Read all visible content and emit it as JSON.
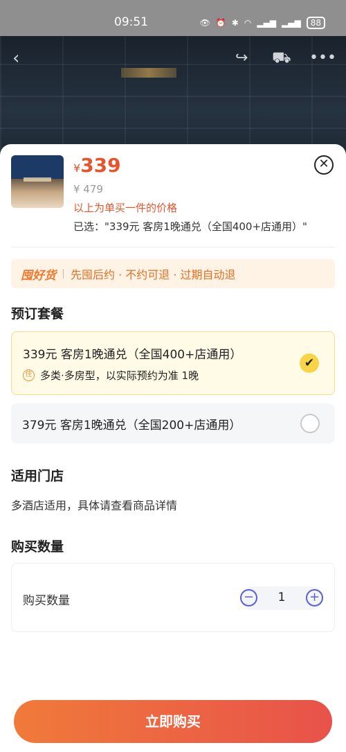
{
  "status_bar": {
    "time": "09:51",
    "battery": "88",
    "signal_icons": [
      "eye-icon",
      "alarm-icon",
      "bluetooth-icon",
      "wifi-icon",
      "5g-signal-icon",
      "5g-signal-icon"
    ]
  },
  "top_nav": {
    "back_icon": "back-arrow-icon",
    "share_icon": "share-icon",
    "cart_icon": "cart-icon",
    "more_icon": "more-dots-icon"
  },
  "product": {
    "currency_symbol": "¥",
    "price": "339",
    "original_price": "¥ 479",
    "price_note": "以上为单买一件的价格",
    "selected_text": "已选：\"339元 客房1晚通兑（全国400+店通用）\""
  },
  "promo": {
    "tag": "囤好货",
    "text": "先囤后约 · 不约可退 · 过期自动退"
  },
  "package_section": {
    "title": "预订套餐",
    "options": [
      {
        "name": "339元 客房1晚通兑（全国400+店通用）",
        "sub_icon": "住",
        "sub_text": "多类·多房型，以实际预约为准 1晚",
        "selected": true
      },
      {
        "name": "379元 客房1晚通兑（全国200+店通用）",
        "selected": false
      }
    ]
  },
  "store_section": {
    "title": "适用门店",
    "text": "多酒店适用，具体请查看商品详情"
  },
  "quantity_section": {
    "title": "购买数量",
    "label": "购买数量",
    "value": "1",
    "minus": "−",
    "plus": "+"
  },
  "buy_button": {
    "label": "立即购买"
  },
  "colors": {
    "price": "#e8552d",
    "buy_gradient_start": "#f07a3a",
    "buy_gradient_end": "#e8524a",
    "selected_check": "#f8d548",
    "stepper_accent": "#5b5fd6"
  }
}
